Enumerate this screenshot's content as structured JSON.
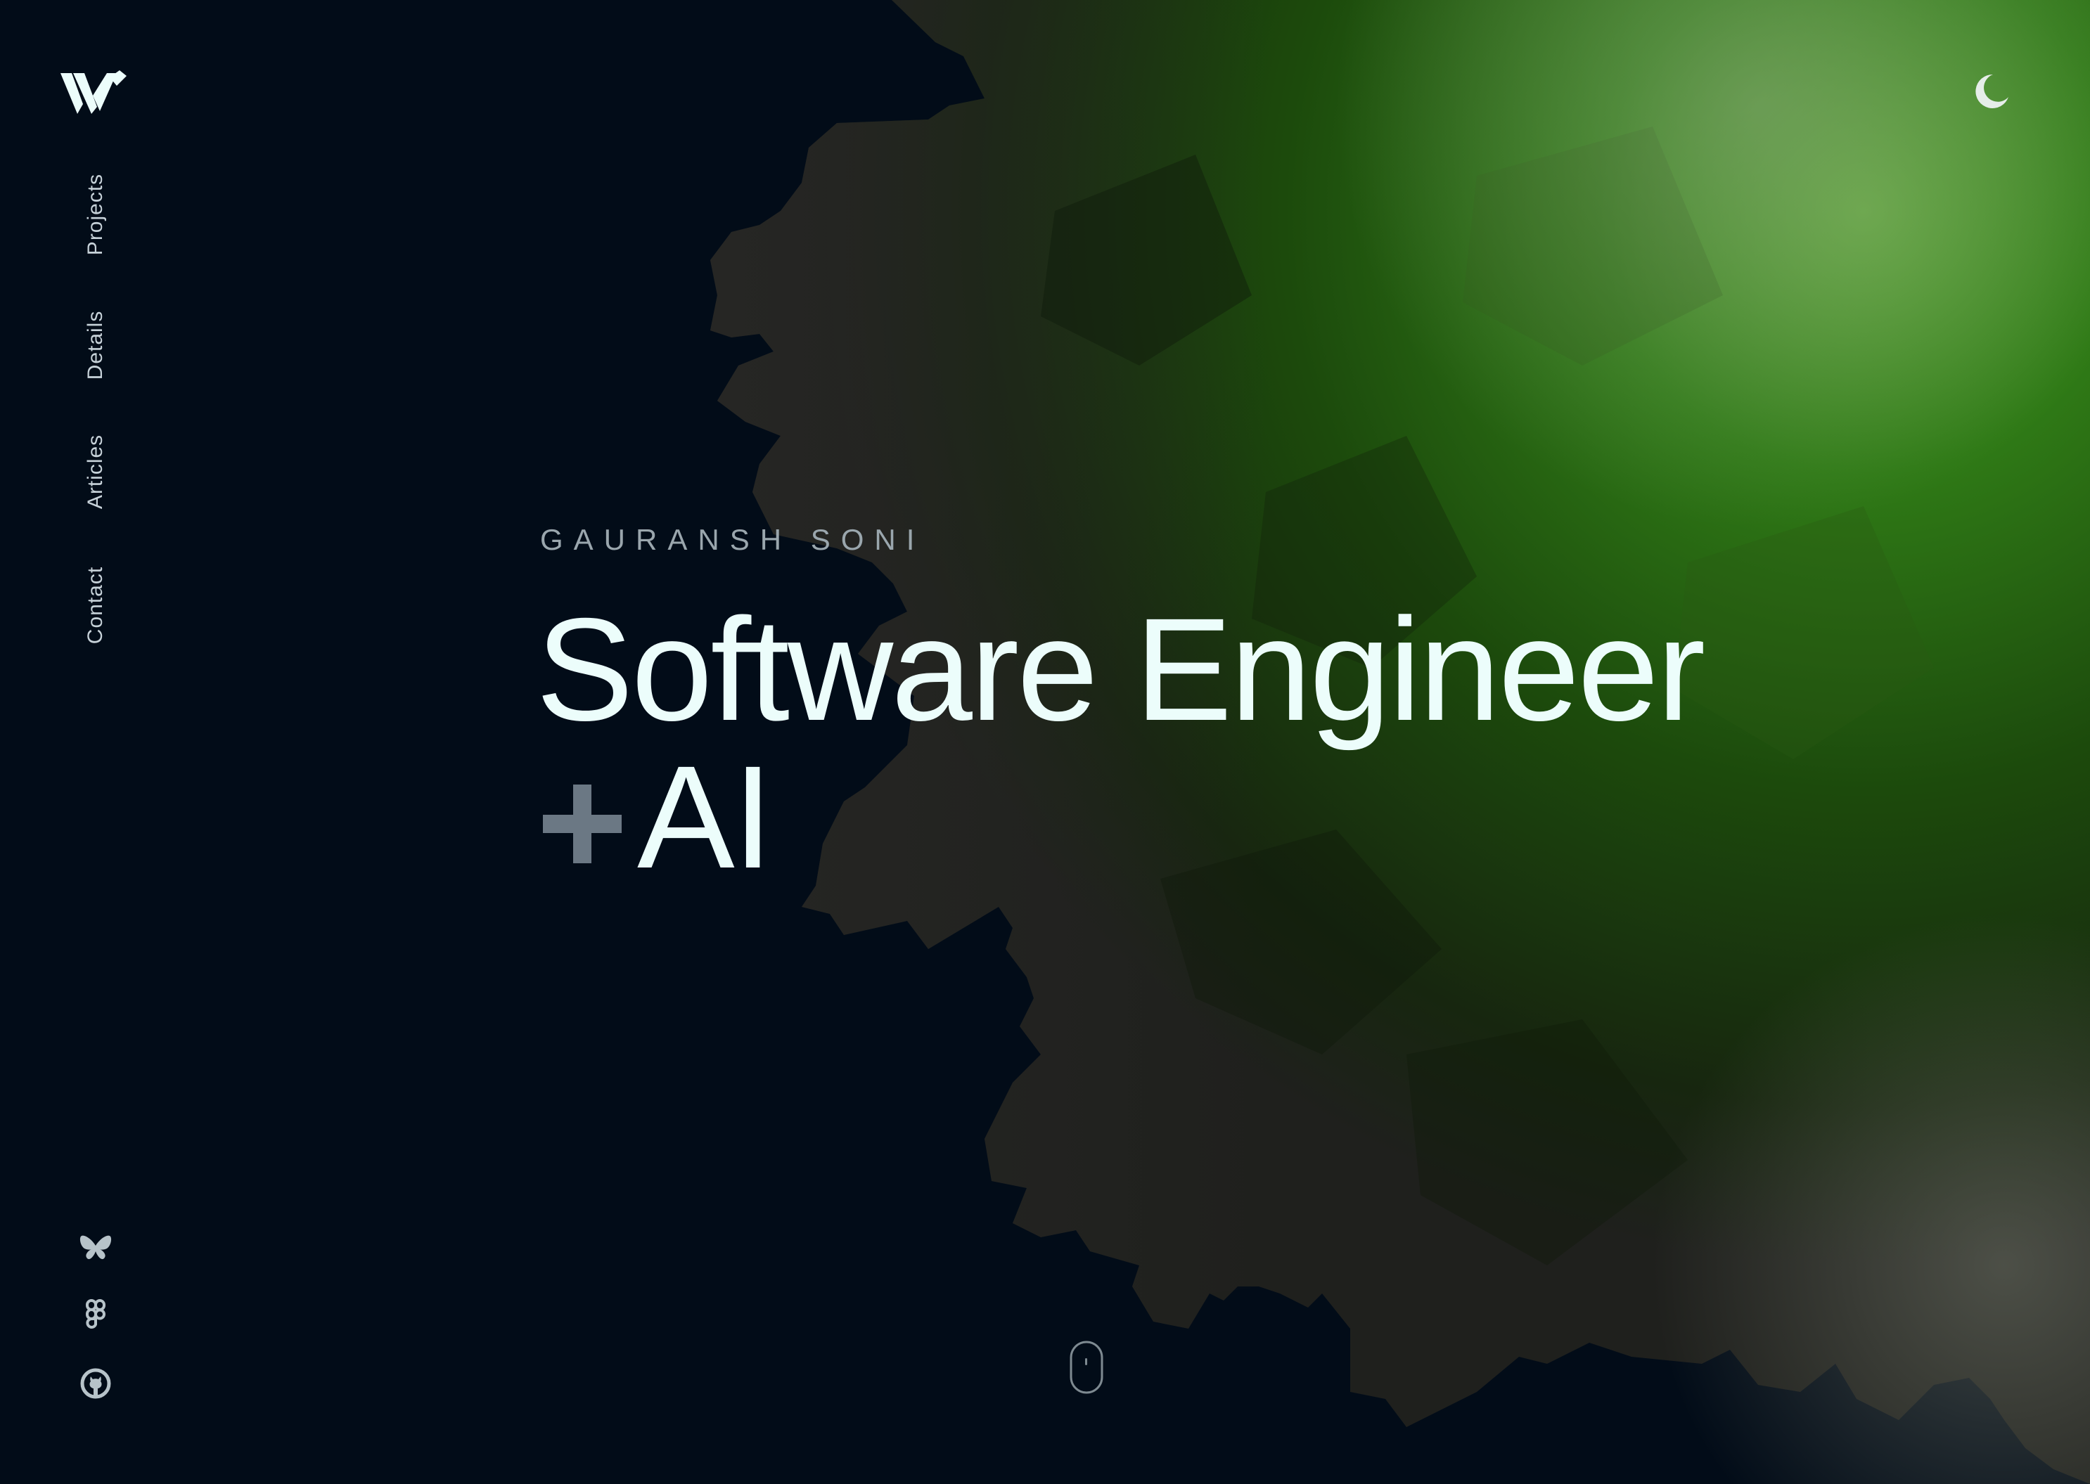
{
  "brand": {
    "logo_icon": "w-monogram-logo"
  },
  "nav": {
    "items": [
      {
        "label": "Projects"
      },
      {
        "label": "Details"
      },
      {
        "label": "Articles"
      },
      {
        "label": "Contact"
      }
    ]
  },
  "header": {
    "theme_toggle_icon": "moon-icon"
  },
  "hero": {
    "name": "GAURANSH SONI",
    "title_line1": "Software Engineer",
    "title_plus_icon": "plus-icon",
    "title_line2": "AI"
  },
  "social": [
    {
      "icon": "bluesky-butterfly-icon"
    },
    {
      "icon": "figma-icon"
    },
    {
      "icon": "github-icon"
    }
  ],
  "scroll": {
    "icon": "mouse-scroll-icon"
  },
  "colors": {
    "background": "#020c18",
    "text_primary": "#ecfdfb",
    "text_muted": "#9aa6ad",
    "accent_green": "#3a8a1c"
  }
}
